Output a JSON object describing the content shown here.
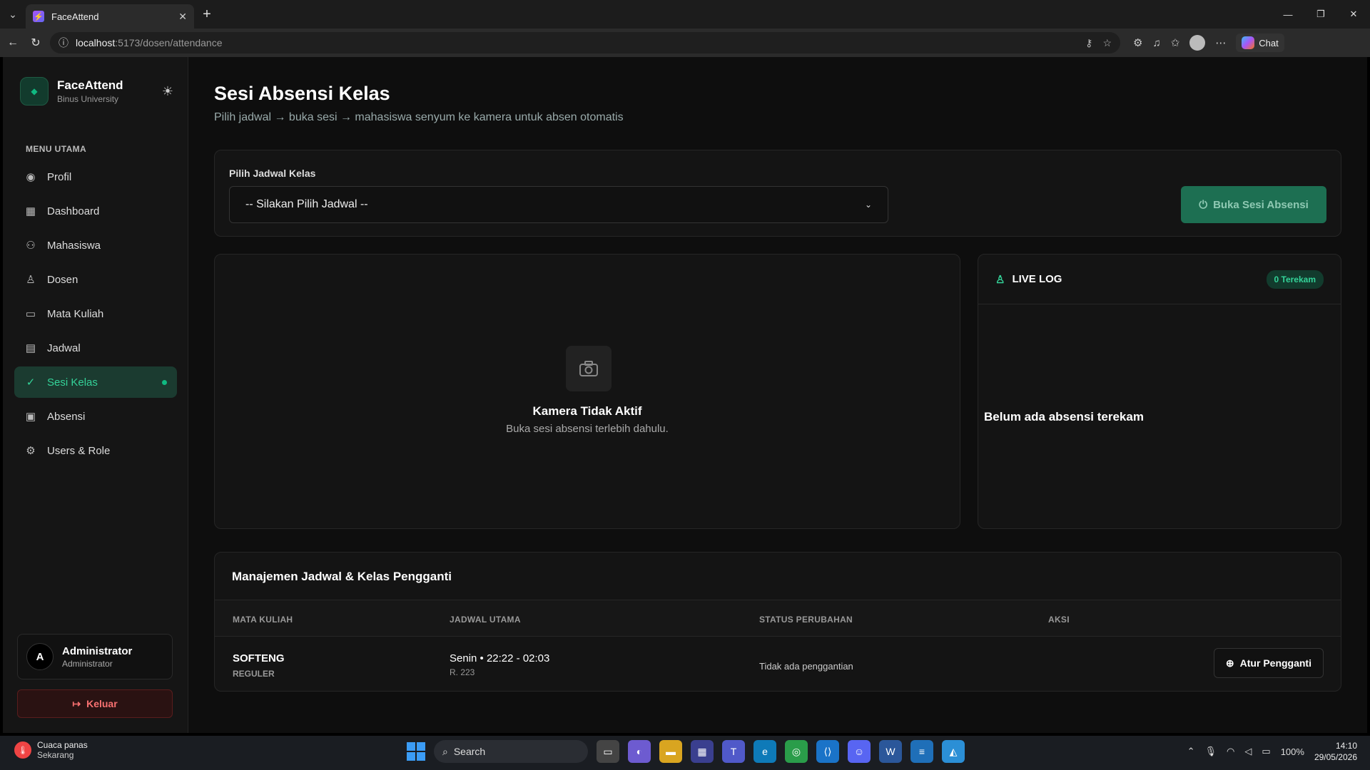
{
  "browser": {
    "tab_title": "FaceAttend",
    "url_host": "localhost",
    "url_path": ":5173/dosen/attendance",
    "chat_label": "Chat"
  },
  "brand": {
    "title": "FaceAttend",
    "subtitle": "Binus University"
  },
  "sidebar": {
    "menu_header": "MENU UTAMA",
    "items": [
      {
        "label": "Profil",
        "icon": "user-circle-icon"
      },
      {
        "label": "Dashboard",
        "icon": "grid-icon"
      },
      {
        "label": "Mahasiswa",
        "icon": "users-icon"
      },
      {
        "label": "Dosen",
        "icon": "user-key-icon"
      },
      {
        "label": "Mata Kuliah",
        "icon": "book-icon"
      },
      {
        "label": "Jadwal",
        "icon": "calendar-icon"
      },
      {
        "label": "Sesi Kelas",
        "icon": "check-circle-icon",
        "active": true
      },
      {
        "label": "Absensi",
        "icon": "clipboard-icon"
      },
      {
        "label": "Users & Role",
        "icon": "gear-icon"
      }
    ],
    "user": {
      "initial": "A",
      "name": "Administrator",
      "role": "Administrator"
    },
    "logout_label": "Keluar"
  },
  "page": {
    "title": "Sesi Absensi Kelas",
    "subtitle": "Pilih jadwal → buka sesi → mahasiswa senyum ke kamera untuk absen otomatis"
  },
  "schedule": {
    "label": "Pilih Jadwal Kelas",
    "selected": "-- Silakan Pilih Jadwal --",
    "open_button": "Buka Sesi Absensi"
  },
  "camera": {
    "title": "Kamera Tidak Aktif",
    "subtitle": "Buka sesi absensi terlebih dahulu."
  },
  "live_log": {
    "title": "LIVE LOG",
    "badge": "0 Terekam",
    "empty": "Belum ada absensi terekam"
  },
  "table": {
    "title": "Manajemen Jadwal & Kelas Pengganti",
    "headers": [
      "MATA KULIAH",
      "JADWAL UTAMA",
      "STATUS PERUBAHAN",
      "AKSI"
    ],
    "rows": [
      {
        "course": "SOFTENG",
        "type": "REGULER",
        "schedule": "Senin • 22:22 - 02:03",
        "room": "R. 223",
        "status": "Tidak ada penggantian",
        "action": "Atur Pengganti"
      }
    ]
  },
  "taskbar": {
    "weather_title": "Cuaca panas",
    "weather_sub": "Sekarang",
    "search_placeholder": "Search",
    "battery": "100%",
    "time": "14:10",
    "date": "29/05/2026"
  },
  "colors": {
    "accent": "#10b981",
    "danger": "#f87171",
    "background": "#0e0e0e"
  }
}
